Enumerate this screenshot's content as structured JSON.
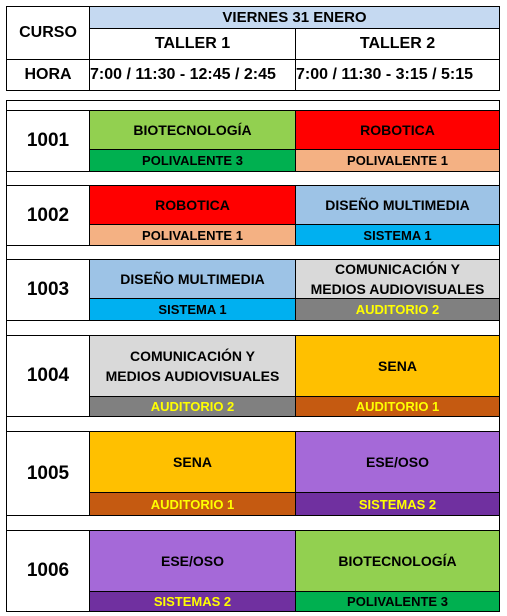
{
  "header": {
    "curso_label": "CURSO",
    "date": "VIERNES 31 ENERO",
    "taller1": "TALLER 1",
    "taller2": "TALLER 2",
    "hora_label": "HORA",
    "hora1": "7:00 / 11:30 - 12:45 / 2:45",
    "hora2": "7:00 / 11:30 - 3:15 / 5:15"
  },
  "colors": {
    "header_blue": "#c5d9f1",
    "green": "#92d050",
    "dark_green": "#00b050",
    "red": "#ff0000",
    "salmon": "#f4b183",
    "light_blue": "#9dc3e6",
    "cyan": "#00b0f0",
    "gray": "#d9d9d9",
    "dark_gray": "#808080",
    "orange": "#ffc000",
    "brown": "#c55a11",
    "purple": "#a569d8",
    "dark_purple": "#7030a0"
  },
  "rows": [
    {
      "course": "1001",
      "t1": {
        "subject": "BIOTECNOLOGÍA",
        "room": "POLIVALENTE 3"
      },
      "t2": {
        "subject": "ROBOTICA",
        "room": "POLIVALENTE 1"
      }
    },
    {
      "course": "1002",
      "t1": {
        "subject": "ROBOTICA",
        "room": "POLIVALENTE 1"
      },
      "t2": {
        "subject": "DISEÑO MULTIMEDIA",
        "room": "SISTEMA 1"
      }
    },
    {
      "course": "1003",
      "t1": {
        "subject": "DISEÑO MULTIMEDIA",
        "room": "SISTEMA 1"
      },
      "t2": {
        "subject": "COMUNICACIÓN Y MEDIOS AUDIOVISUALES",
        "room": "AUDITORIO 2"
      }
    },
    {
      "course": "1004",
      "t1": {
        "subject": "COMUNICACIÓN Y MEDIOS AUDIOVISUALES",
        "room": "AUDITORIO 2"
      },
      "t2": {
        "subject": "SENA",
        "room": "AUDITORIO 1"
      }
    },
    {
      "course": "1005",
      "t1": {
        "subject": "SENA",
        "room": "AUDITORIO 1"
      },
      "t2": {
        "subject": "ESE/OSO",
        "room": "SISTEMAS 2"
      }
    },
    {
      "course": "1006",
      "t1": {
        "subject": "ESE/OSO",
        "room": "SISTEMAS 2"
      },
      "t2": {
        "subject": "BIOTECNOLOGÍA",
        "room": "POLIVALENTE 3"
      }
    }
  ]
}
